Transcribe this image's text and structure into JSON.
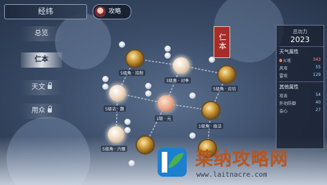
{
  "header": {
    "title": "经纬",
    "guide_label": "攻略"
  },
  "menu": [
    {
      "label": "总览",
      "locked": false,
      "active": false
    },
    {
      "label": "仁本",
      "locked": false,
      "active": true
    },
    {
      "label": "天文",
      "locked": true,
      "active": false
    },
    {
      "label": "用众",
      "locked": true,
      "active": false
    }
  ],
  "banner": {
    "text": "仁本"
  },
  "tree": {
    "nodes": [
      {
        "id": "n1",
        "label": "5级角 · 拾粉",
        "kind": "gold"
      },
      {
        "id": "n2",
        "label": "3级角 · 对季",
        "kind": "pearl"
      },
      {
        "id": "n3",
        "label": "5级角 · 应坊",
        "kind": "gold"
      },
      {
        "id": "n4",
        "label": "5级诂 · 魏",
        "kind": "pearl"
      },
      {
        "id": "n5",
        "label": "1级 · 元",
        "kind": "peach"
      },
      {
        "id": "n6",
        "label": "1级角 · 级法",
        "kind": "gold"
      },
      {
        "id": "n7",
        "label": "5级角 · 六眼",
        "kind": "pearl"
      },
      {
        "id": "n8",
        "label": "",
        "kind": "gold"
      },
      {
        "id": "n9",
        "label": "",
        "kind": "gold"
      }
    ]
  },
  "stats": {
    "power_label": "总功力",
    "power_value": "2023",
    "weather_title": "天气属性",
    "weather": [
      {
        "label": "火攻",
        "value": "343",
        "accent": true
      },
      {
        "label": "风攻",
        "value": "55"
      },
      {
        "label": "雷攻",
        "value": "129"
      }
    ],
    "other_title": "其他属性",
    "other": [
      {
        "label": "攻击",
        "value": "54"
      },
      {
        "label": "外功防御",
        "value": "40"
      },
      {
        "label": "会心",
        "value": "27"
      }
    ]
  },
  "watermark": {
    "title": "莱纳攻略网",
    "url": "www.laitnacre.com"
  },
  "colors": {
    "banner": "#a52d2a",
    "watermark": "#b8551e",
    "accent": "#9fd3ff"
  }
}
